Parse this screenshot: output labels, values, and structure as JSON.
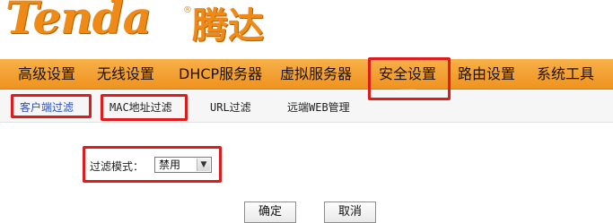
{
  "logo": {
    "brand": "Tenda",
    "registered": "®",
    "brand_cn": "腾达"
  },
  "nav": {
    "items": [
      "高级设置",
      "无线设置",
      "DHCP服务器",
      "虚拟服务器",
      "安全设置",
      "路由设置",
      "系统工具"
    ],
    "active": "安全设置"
  },
  "subnav": {
    "items": [
      "客户端过滤",
      "MAC地址过滤",
      "URL过滤",
      "远端WEB管理"
    ],
    "active": "客户端过滤"
  },
  "filter": {
    "label": "过滤模式：",
    "selected": "禁用"
  },
  "buttons": {
    "ok": "确定",
    "cancel": "取消"
  },
  "colors": {
    "accent": "#ef9320",
    "highlight": "#e01b1b"
  }
}
